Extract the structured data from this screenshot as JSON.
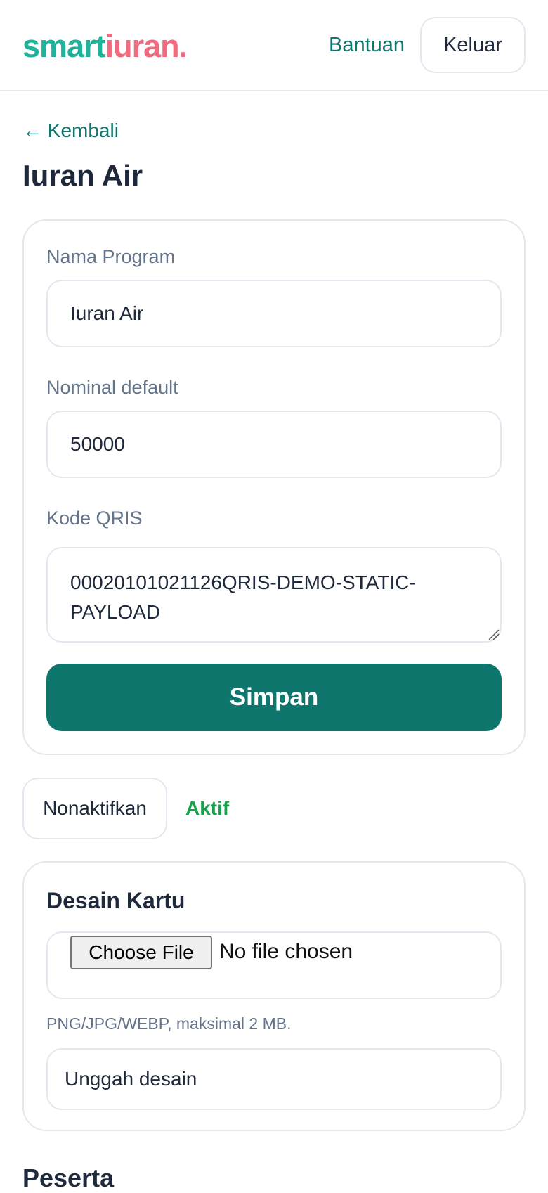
{
  "header": {
    "logo_part1": "smart",
    "logo_part2": "iuran.",
    "help_link": "Bantuan",
    "logout_button": "Keluar"
  },
  "nav": {
    "back_link": "← Kembali"
  },
  "page": {
    "title": "Iuran Air"
  },
  "form": {
    "program_name_label": "Nama Program",
    "program_name_value": "Iuran Air",
    "nominal_label": "Nominal default",
    "nominal_value": "50000",
    "qris_label": "Kode QRIS",
    "qris_value": "00020101021126QRIS-DEMO-STATIC-PAYLOAD",
    "save_button": "Simpan"
  },
  "status": {
    "deactivate_button": "Nonaktifkan",
    "active_label": "Aktif"
  },
  "card_design": {
    "title": "Desain Kartu",
    "choose_file_button": "Choose File",
    "file_status": "No file chosen",
    "hint": "PNG/JPG/WEBP, maksimal 2 MB.",
    "upload_button": "Unggah desain"
  },
  "participants": {
    "title": "Peserta"
  },
  "colors": {
    "brand_primary": "#0f766e",
    "logo_teal": "#20b29b",
    "logo_pink": "#f06b7e",
    "status_active": "#16a34a"
  }
}
